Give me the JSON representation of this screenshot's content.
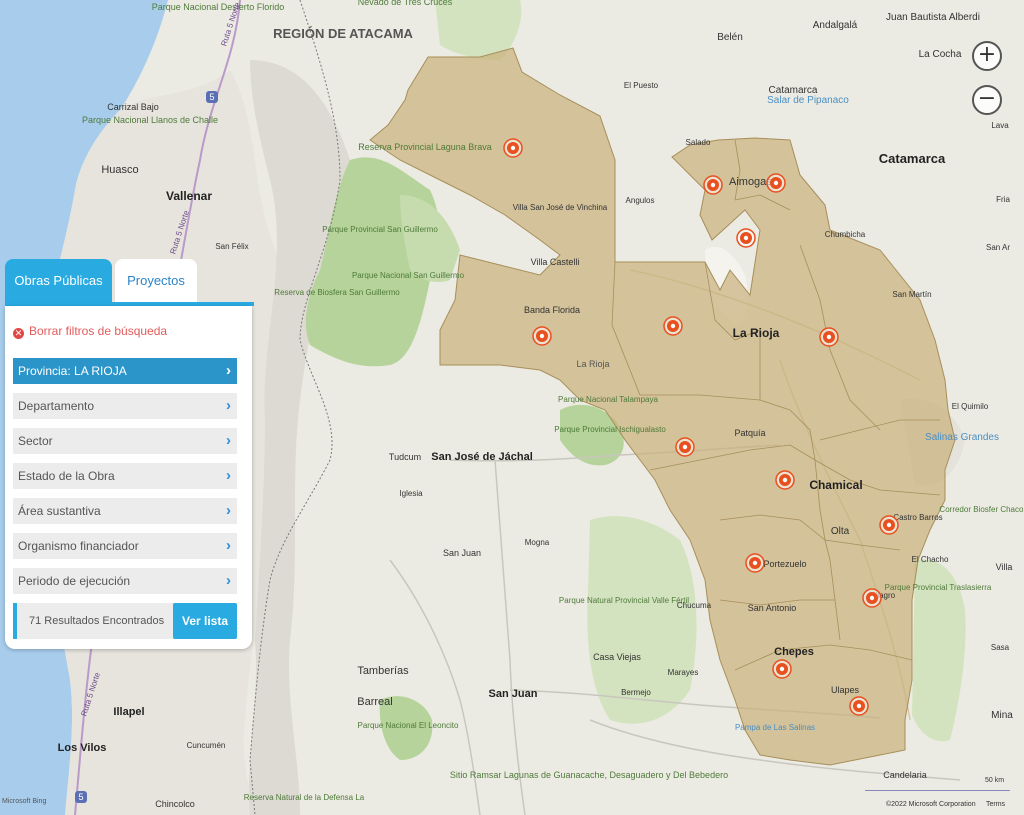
{
  "panel": {
    "tabs": [
      {
        "label": "Obras Públicas",
        "active": true
      },
      {
        "label": "Proyectos",
        "active": false
      }
    ],
    "clear_filters": "Borrar filtros de búsqueda",
    "filters": [
      {
        "label": "Provincia: LA RIOJA",
        "active": true
      },
      {
        "label": "Departamento",
        "active": false
      },
      {
        "label": "Sector",
        "active": false
      },
      {
        "label": "Estado de la Obra",
        "active": false
      },
      {
        "label": "Área sustantiva",
        "active": false
      },
      {
        "label": "Organismo financiador",
        "active": false
      },
      {
        "label": "Periodo de ejecución",
        "active": false
      }
    ],
    "results_text": "71 Resultados Encontrados",
    "view_list_button": "Ver lista"
  },
  "zoom": {
    "in": "+",
    "out": "−"
  },
  "attribution": {
    "bing_logo": "Microsoft Bing",
    "copyright": "©2022 Microsoft Corporation",
    "terms": "Terms",
    "scale": "50 km"
  },
  "colors": {
    "accent": "#29abe2",
    "province_fill": "#c9b27e",
    "marker": "#e8501f",
    "park_green": "#b5d39a",
    "sea": "#a8cdec"
  },
  "map": {
    "labels": [
      {
        "text": "REGIÓN DE ATACAMA",
        "type": "region"
      },
      {
        "text": "Parque Nacional Desierto Florido",
        "type": "park"
      },
      {
        "text": "Nevado de Tres Cruces",
        "type": "park"
      },
      {
        "text": "Carrizal Bajo",
        "type": "town"
      },
      {
        "text": "Parque Nacional Llanos de Challe",
        "type": "park"
      },
      {
        "text": "Huasco",
        "type": "town"
      },
      {
        "text": "Vallenar",
        "type": "city"
      },
      {
        "text": "San Félix",
        "type": "town"
      },
      {
        "text": "Reserva Provincial Laguna Brava",
        "type": "park"
      },
      {
        "text": "Parque Provincial San Guillermo",
        "type": "park"
      },
      {
        "text": "Parque Nacional San Guillermo",
        "type": "park"
      },
      {
        "text": "Reserva de Biosfera San Guillermo",
        "type": "park"
      },
      {
        "text": "Villa San José de Vinchina",
        "type": "town"
      },
      {
        "text": "Villa Castelli",
        "type": "town"
      },
      {
        "text": "Banda Florida",
        "type": "town"
      },
      {
        "text": "La Rioja",
        "type": "region"
      },
      {
        "text": "Parque Nacional Talampaya",
        "type": "park"
      },
      {
        "text": "Parque Provincial Ischigualasto",
        "type": "park"
      },
      {
        "text": "Belén",
        "type": "town"
      },
      {
        "text": "Andalgalá",
        "type": "town"
      },
      {
        "text": "Juan Bautista Alberdi",
        "type": "town"
      },
      {
        "text": "La Cocha",
        "type": "town"
      },
      {
        "text": "El Puesto",
        "type": "town"
      },
      {
        "text": "Catamarca",
        "type": "town"
      },
      {
        "text": "Salar de Pipanaco",
        "type": "water"
      },
      {
        "text": "Salado",
        "type": "town"
      },
      {
        "text": "Aimogasta",
        "type": "town"
      },
      {
        "text": "Angulos",
        "type": "town"
      },
      {
        "text": "Chumbicha",
        "type": "town"
      },
      {
        "text": "Catamarca",
        "type": "city"
      },
      {
        "text": "Fria",
        "type": "town"
      },
      {
        "text": "San Ar",
        "type": "town"
      },
      {
        "text": "San Martín",
        "type": "town"
      },
      {
        "text": "La Rioja",
        "type": "city"
      },
      {
        "text": "Lava",
        "type": "town"
      },
      {
        "text": "El Quimilo",
        "type": "town"
      },
      {
        "text": "Salinas Grandes",
        "type": "water"
      },
      {
        "text": "Patquía",
        "type": "town"
      },
      {
        "text": "Chamical",
        "type": "city"
      },
      {
        "text": "Castro Barros",
        "type": "town"
      },
      {
        "text": "Corredor Biosfer Chaco A",
        "type": "park"
      },
      {
        "text": "Olta",
        "type": "town"
      },
      {
        "text": "El Chacho",
        "type": "town"
      },
      {
        "text": "Villa",
        "type": "town"
      },
      {
        "text": "Parque Provincial Traslasierra",
        "type": "park"
      },
      {
        "text": "Portezuelo",
        "type": "town"
      },
      {
        "text": "Tudcum",
        "type": "town"
      },
      {
        "text": "San José de Jáchal",
        "type": "city"
      },
      {
        "text": "Iglesia",
        "type": "town"
      },
      {
        "text": "San Juan",
        "type": "town"
      },
      {
        "text": "Mogna",
        "type": "town"
      },
      {
        "text": "Parque Natural Provincial Valle Fértil",
        "type": "park"
      },
      {
        "text": "Chucuma",
        "type": "town"
      },
      {
        "text": "San Antonio",
        "type": "town"
      },
      {
        "text": "Milagro",
        "type": "town"
      },
      {
        "text": "Chepes",
        "type": "city"
      },
      {
        "text": "Casa Viejas",
        "type": "town"
      },
      {
        "text": "Marayes",
        "type": "town"
      },
      {
        "text": "Tamberías",
        "type": "town"
      },
      {
        "text": "Barreal",
        "type": "town"
      },
      {
        "text": "San Juan",
        "type": "city"
      },
      {
        "text": "Bermejo",
        "type": "town"
      },
      {
        "text": "Ulapes",
        "type": "town"
      },
      {
        "text": "Sasa",
        "type": "town"
      },
      {
        "text": "Mina",
        "type": "town"
      },
      {
        "text": "Parque Nacional El Leoncito",
        "type": "park"
      },
      {
        "text": "Pampa de Las Salinas",
        "type": "water"
      },
      {
        "text": "Illapel",
        "type": "city"
      },
      {
        "text": "Los Vilos",
        "type": "city"
      },
      {
        "text": "Cuncumén",
        "type": "town"
      },
      {
        "text": "Chincolco",
        "type": "town"
      },
      {
        "text": "Reserva Natural de la Defensa La",
        "type": "park"
      },
      {
        "text": "Sitio Ramsar Lagunas de Guanacache, Desaguadero y Del Bebedero",
        "type": "park"
      },
      {
        "text": "Candelaria",
        "type": "town"
      },
      {
        "text": "Ruta 5 Norte",
        "type": "road"
      },
      {
        "text": "Ruta 5 Norte",
        "type": "road"
      },
      {
        "text": "Ruta 5 Norte",
        "type": "road"
      },
      {
        "text": "5",
        "type": "shield"
      },
      {
        "text": "5",
        "type": "shield"
      }
    ],
    "markers_count": 15
  }
}
